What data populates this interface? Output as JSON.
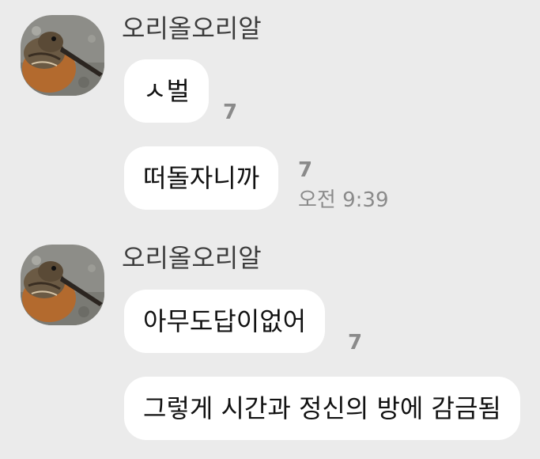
{
  "colors": {
    "background": "#ebebeb",
    "bubble": "#ffffff",
    "meta_text": "#8a8a8a"
  },
  "groups": [
    {
      "sender": "오리올오리알",
      "avatar_icon": "woodcock-bird-avatar",
      "messages": [
        {
          "text": "ㅅ벌",
          "unread": "7"
        },
        {
          "text": "떠돌자니까",
          "unread": "7",
          "time": "오전 9:39"
        }
      ]
    },
    {
      "sender": "오리올오리알",
      "avatar_icon": "woodcock-bird-avatar",
      "messages": [
        {
          "text": "아무도답이없어",
          "unread": "7"
        },
        {
          "text": "그렇게 시간과 정신의 방에 감금됨"
        }
      ]
    }
  ]
}
